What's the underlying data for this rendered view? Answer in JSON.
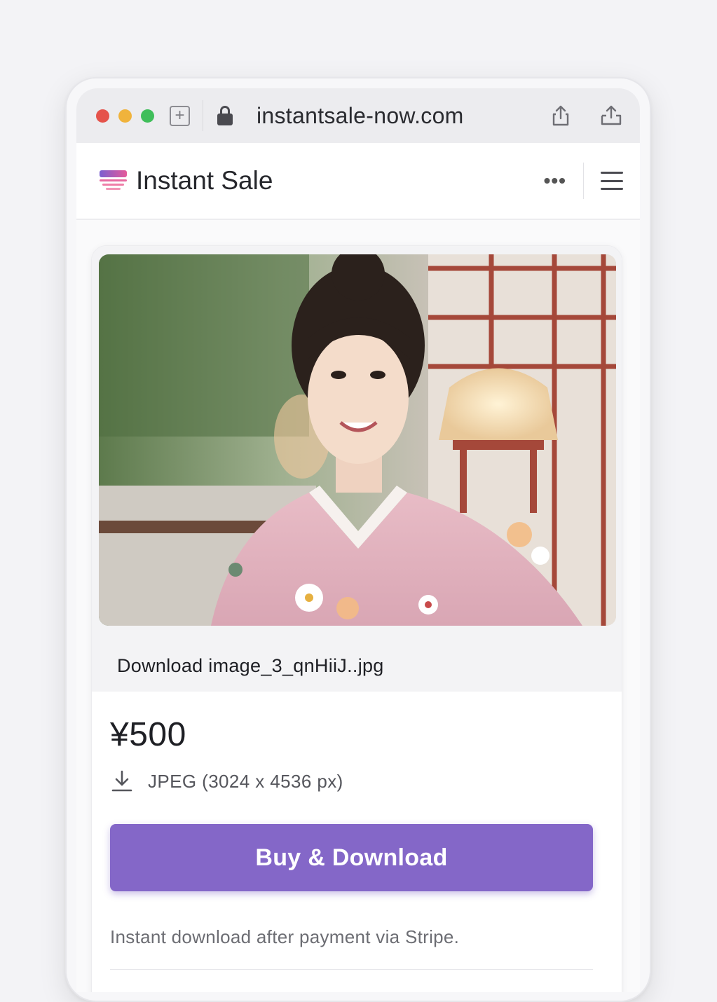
{
  "browser": {
    "url": "instantsale-now.com",
    "icons": [
      "close-dot",
      "minimize-dot",
      "zoom-dot",
      "new-tab-icon",
      "lock-icon",
      "share-icon",
      "share-icon"
    ]
  },
  "header": {
    "brand": "Instant Sale",
    "more_label": "•••",
    "icons": [
      "logo-icon",
      "more-icon",
      "hamburger-icon"
    ]
  },
  "product": {
    "filename": "Download image_3_qnHiiJ..jpg",
    "price": "¥500",
    "format": "JPEG (3024 x 4536 px)",
    "buy_label": "Buy & Download",
    "note": "Instant download after payment via Stripe."
  },
  "colors": {
    "accent": "#8467c8",
    "chrome": "#ececef",
    "dot_red": "#e5534b",
    "dot_yellow": "#f0b33c",
    "dot_green": "#3fbe5a"
  }
}
